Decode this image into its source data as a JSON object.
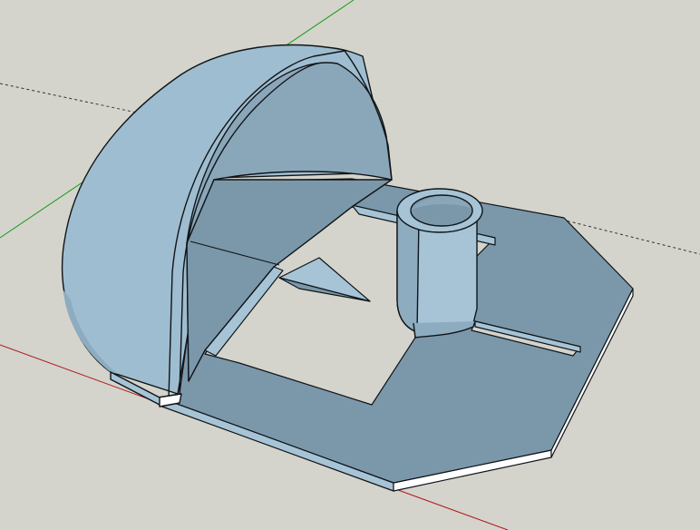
{
  "scene": {
    "background": "#d4d4cc",
    "axis_colors": {
      "red": "#b01818",
      "green": "#1a9a1a",
      "blue_dotted": "#333333"
    },
    "model_colors": {
      "top_face": "#7b98aa",
      "top_face_light": "#8aa7ba",
      "side_face": "#a6c4d6",
      "side_dark": "#5f7c8e",
      "dome_outer": "#9fbdd0",
      "dome_outer_shade": "#8eacc0",
      "dome_inner": "#8aa7b9",
      "edge_white": "#ffffff",
      "edge_line": "#101418"
    },
    "objects": [
      "octagonal-base-plate",
      "square-cutout",
      "half-dome-shell",
      "hollow-cylinder-post",
      "triangular-wedge",
      "narrow-slot"
    ]
  }
}
